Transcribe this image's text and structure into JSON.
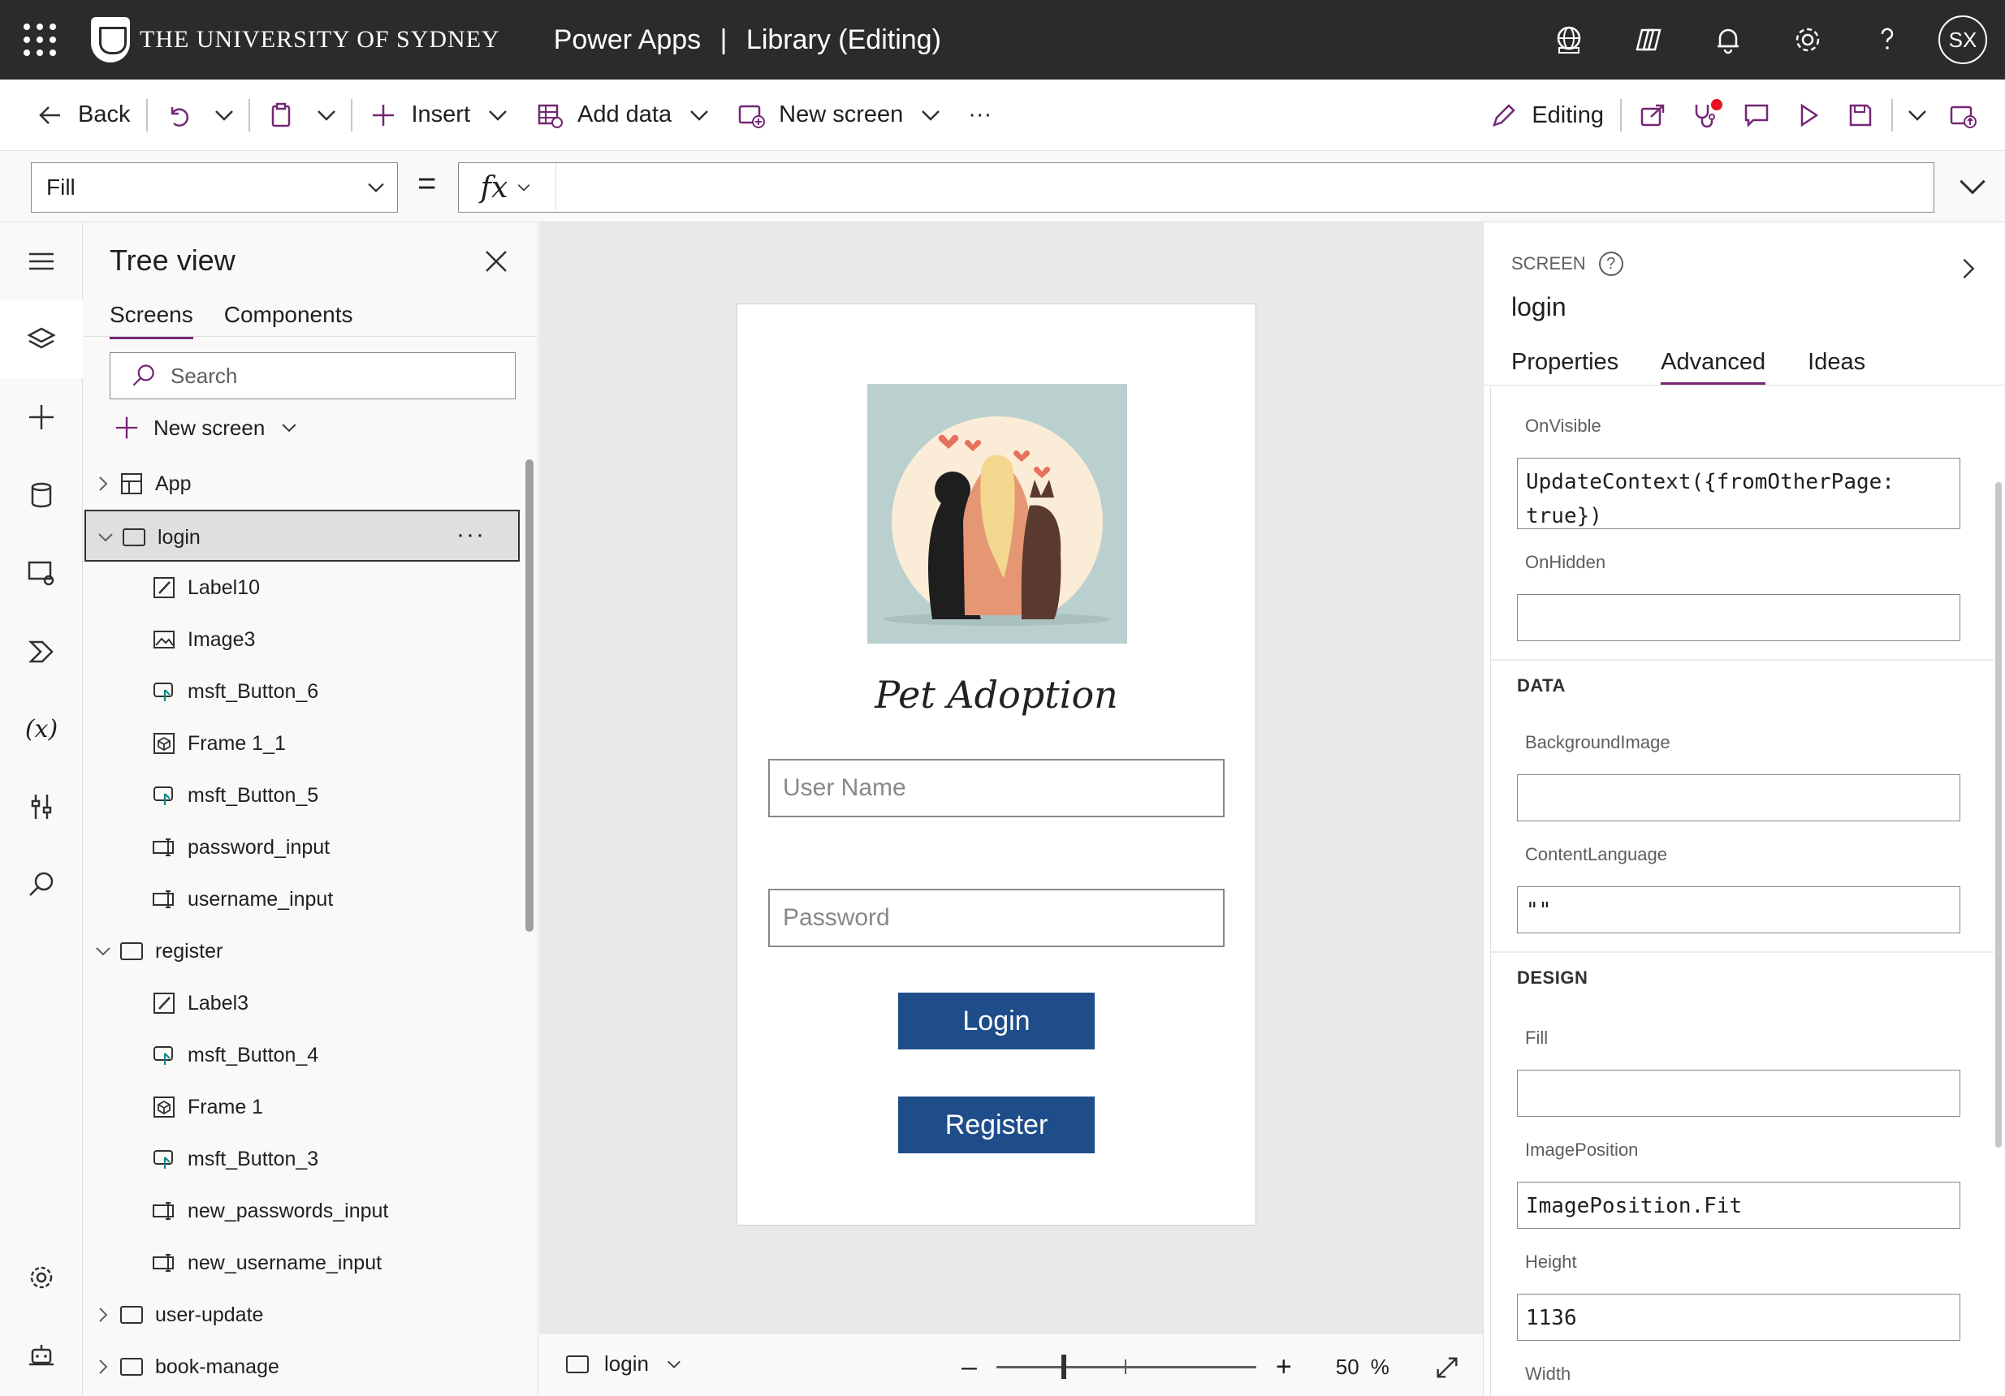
{
  "header": {
    "org_name": "THE UNIVERSITY OF SYDNEY",
    "product": "Power Apps",
    "separator": "|",
    "doc_title": "Library (Editing)",
    "avatar_initials": "SX"
  },
  "commands": {
    "back": "Back",
    "insert": "Insert",
    "add_data": "Add data",
    "new_screen": "New screen",
    "more": "···",
    "editing": "Editing"
  },
  "formula": {
    "property": "Fill",
    "equals": "=",
    "fx": "fx",
    "value": ""
  },
  "tree": {
    "title": "Tree view",
    "tabs": [
      "Screens",
      "Components"
    ],
    "search_placeholder": "Search",
    "new_screen": "New screen",
    "items": [
      {
        "label": "App",
        "level": 0,
        "type": "app",
        "expander": "collapsed"
      },
      {
        "label": "login",
        "level": 0,
        "type": "screen",
        "expander": "expanded",
        "selected": true
      },
      {
        "label": "Label10",
        "level": 1,
        "type": "label"
      },
      {
        "label": "Image3",
        "level": 1,
        "type": "image"
      },
      {
        "label": "msft_Button_6",
        "level": 1,
        "type": "button"
      },
      {
        "label": "Frame 1_1",
        "level": 1,
        "type": "component"
      },
      {
        "label": "msft_Button_5",
        "level": 1,
        "type": "button"
      },
      {
        "label": "password_input",
        "level": 1,
        "type": "input"
      },
      {
        "label": "username_input",
        "level": 1,
        "type": "input"
      },
      {
        "label": "register",
        "level": 0,
        "type": "screen",
        "expander": "expanded"
      },
      {
        "label": "Label3",
        "level": 1,
        "type": "label"
      },
      {
        "label": "msft_Button_4",
        "level": 1,
        "type": "button"
      },
      {
        "label": "Frame 1",
        "level": 1,
        "type": "component"
      },
      {
        "label": "msft_Button_3",
        "level": 1,
        "type": "button"
      },
      {
        "label": "new_passwords_input",
        "level": 1,
        "type": "input"
      },
      {
        "label": "new_username_input",
        "level": 1,
        "type": "input"
      },
      {
        "label": "user-update",
        "level": 0,
        "type": "screen",
        "expander": "collapsed"
      },
      {
        "label": "book-manage",
        "level": 0,
        "type": "screen",
        "expander": "collapsed"
      }
    ]
  },
  "canvas": {
    "app_title": "Pet Adoption",
    "username_placeholder": "User Name",
    "password_placeholder": "Password",
    "login_label": "Login",
    "register_label": "Register",
    "button_color": "#1f4d8a"
  },
  "footer": {
    "screen": "login",
    "zoom_value": "50",
    "zoom_unit": "%",
    "zoom_fraction": 0.5
  },
  "properties": {
    "kind": "SCREEN",
    "name": "login",
    "tabs": [
      "Properties",
      "Advanced",
      "Ideas"
    ],
    "active_tab": "Advanced",
    "on_visible_label": "OnVisible",
    "on_visible_value": "UpdateContext({fromOtherPage: true})",
    "on_hidden_label": "OnHidden",
    "on_hidden_value": "",
    "data_section": "DATA",
    "background_image_label": "BackgroundImage",
    "background_image_value": "",
    "content_language_label": "ContentLanguage",
    "content_language_value": "\"\"",
    "design_section": "DESIGN",
    "fill_label": "Fill",
    "fill_value": "",
    "image_position_label": "ImagePosition",
    "image_position_value": "ImagePosition.Fit",
    "height_label": "Height",
    "height_value": "1136",
    "width_label": "Width"
  },
  "colors": {
    "accent": "#742774",
    "header_bg": "#2b2b2b",
    "notification_dot": "#e81123"
  }
}
